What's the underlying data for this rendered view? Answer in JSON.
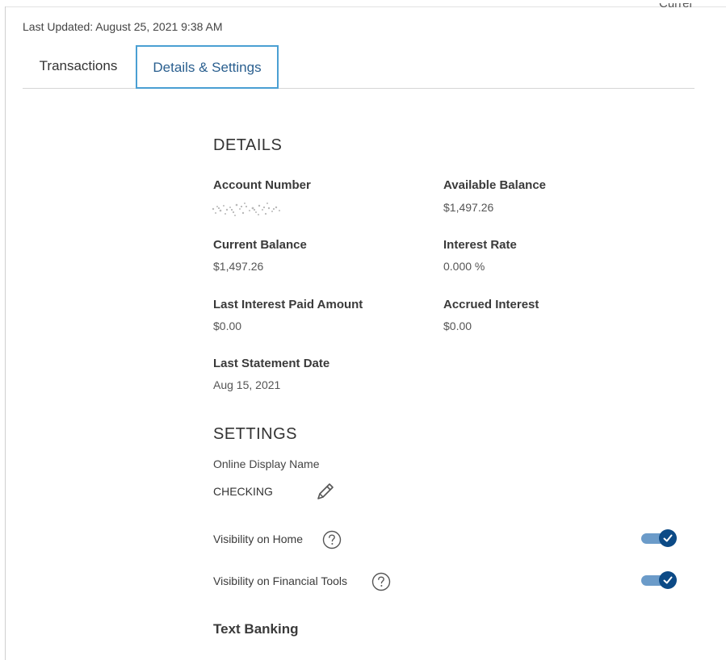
{
  "header": {
    "last_updated": "Last Updated: August 25, 2021 9:38 AM",
    "corner_partial_text": "Currer"
  },
  "tabs": [
    {
      "label": "Transactions",
      "active": false
    },
    {
      "label": "Details & Settings",
      "active": true
    }
  ],
  "details": {
    "title": "DETAILS",
    "account_number_label": "Account Number",
    "available_balance_label": "Available Balance",
    "available_balance_value": "$1,497.26",
    "current_balance_label": "Current Balance",
    "current_balance_value": "$1,497.26",
    "interest_rate_label": "Interest Rate",
    "interest_rate_value": "0.000 %",
    "last_interest_label": "Last Interest Paid Amount",
    "last_interest_value": "$0.00",
    "accrued_interest_label": "Accrued Interest",
    "accrued_interest_value": "$0.00",
    "last_statement_label": "Last Statement Date",
    "last_statement_value": "Aug 15, 2021"
  },
  "settings": {
    "title": "SETTINGS",
    "display_name_label": "Online Display Name",
    "display_name_value": "CHECKING",
    "visibility_home_label": "Visibility on Home",
    "visibility_home_on": true,
    "visibility_tools_label": "Visibility on Financial Tools",
    "visibility_tools_on": true,
    "text_banking_label": "Text Banking"
  },
  "colors": {
    "tab_active_border": "#4a9fd3",
    "tab_active_text": "#2a5f8f",
    "toggle_track": "#6b9bc9",
    "toggle_knob": "#0c4a86"
  },
  "icons": {
    "edit": "pencil-icon",
    "help": "question-circle-icon",
    "toggle_check": "checkmark-icon"
  }
}
